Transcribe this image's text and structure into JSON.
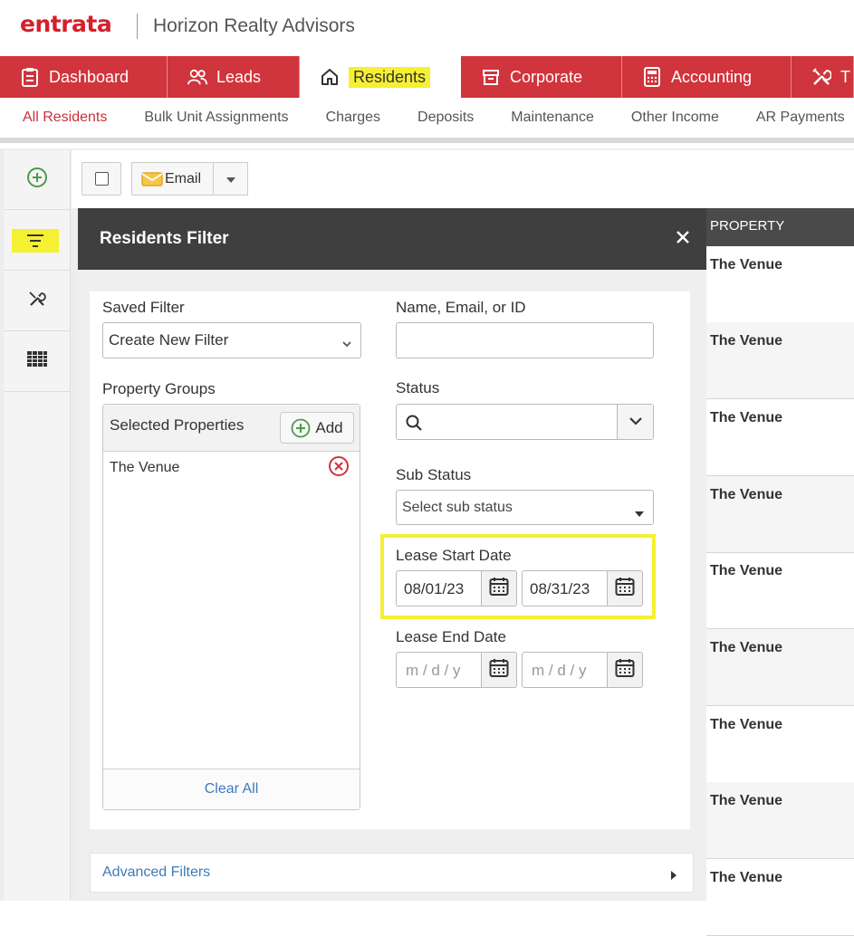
{
  "header": {
    "logo": "entrata",
    "company": "Horizon Realty Advisors"
  },
  "main_nav": {
    "tabs": [
      {
        "label": "Dashboard",
        "icon": "clipboard-icon"
      },
      {
        "label": "Leads",
        "icon": "people-icon"
      },
      {
        "label": "Residents",
        "icon": "home-icon",
        "active": true
      },
      {
        "label": "Corporate",
        "icon": "box-icon"
      },
      {
        "label": "Accounting",
        "icon": "calculator-icon"
      },
      {
        "label": "T",
        "icon": "tools-icon"
      }
    ]
  },
  "sub_nav": {
    "items": [
      "All Residents",
      "Bulk Unit Assignments",
      "Charges",
      "Deposits",
      "Maintenance",
      "Other Income",
      "AR Payments"
    ],
    "active": "All Residents"
  },
  "toolbar": {
    "email_label": "Email"
  },
  "panel": {
    "title": "Residents Filter",
    "saved_filter_label": "Saved Filter",
    "saved_filter_value": "Create New Filter",
    "property_groups_label": "Property Groups",
    "selected_properties_label": "Selected Properties",
    "add_label": "Add",
    "properties": [
      "The Venue"
    ],
    "clear_all_label": "Clear All",
    "name_label": "Name, Email, or ID",
    "name_value": "",
    "status_label": "Status",
    "sub_status_label": "Sub Status",
    "sub_status_placeholder": "Select sub status",
    "lease_start_label": "Lease Start Date",
    "lease_start_from": "08/01/23",
    "lease_start_to": "08/31/23",
    "lease_end_label": "Lease End Date",
    "lease_end_from_placeholder": "m / d / y",
    "lease_end_to_placeholder": "m / d / y",
    "advanced_filters_label": "Advanced Filters"
  },
  "table": {
    "column_header": "PROPERTY",
    "rows": [
      "The Venue",
      "The Venue",
      "The Venue",
      "The Venue",
      "The Venue",
      "The Venue",
      "The Venue",
      "The Venue",
      "The Venue"
    ]
  },
  "colors": {
    "brand_red": "#d0343c",
    "highlight_yellow": "#f5f032",
    "link_blue": "#3d7ab8"
  }
}
